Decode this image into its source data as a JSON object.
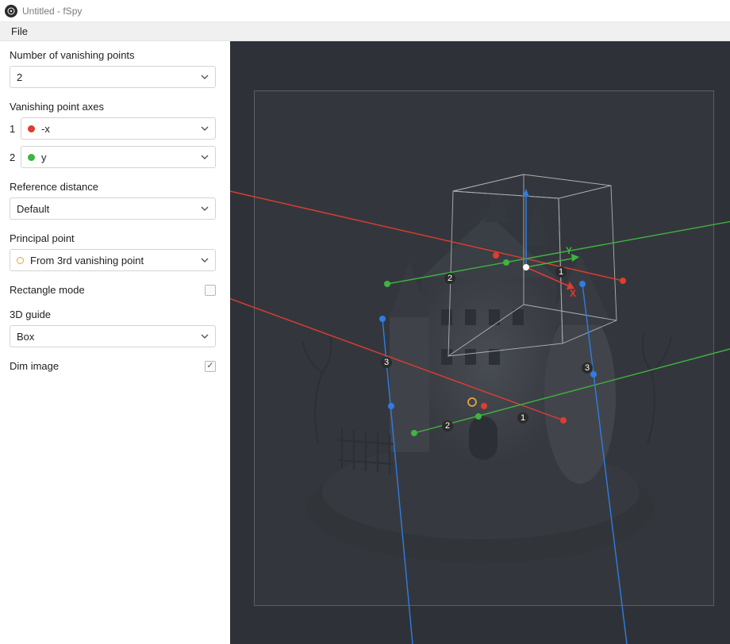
{
  "window": {
    "title": "Untitled - fSpy"
  },
  "menu": {
    "file": "File"
  },
  "sidebar": {
    "num_vp": {
      "label": "Number of vanishing points",
      "value": "2"
    },
    "vp_axes": {
      "label": "Vanishing point axes",
      "rows": [
        {
          "index": "1",
          "value": "-x",
          "color": "red"
        },
        {
          "index": "2",
          "value": "y",
          "color": "green"
        }
      ]
    },
    "ref_dist": {
      "label": "Reference distance",
      "value": "Default"
    },
    "principal": {
      "label": "Principal point",
      "value": "From 3rd vanishing point"
    },
    "rect_mode": {
      "label": "Rectangle mode",
      "checked": false
    },
    "guide3d": {
      "label": "3D guide",
      "value": "Box"
    },
    "dim_image": {
      "label": "Dim image",
      "checked": true
    }
  },
  "viewport": {
    "line_labels": {
      "one_a": "1",
      "one_b": "1",
      "two_a": "2",
      "two_b": "2",
      "three_a": "3",
      "three_b": "3"
    },
    "axis_labels": {
      "y": "Y",
      "x": "X"
    }
  }
}
